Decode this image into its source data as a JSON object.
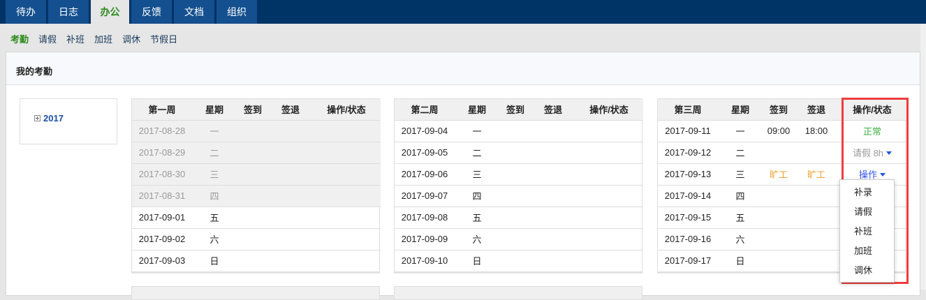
{
  "topnav": {
    "tabs": [
      "待办",
      "日志",
      "办公",
      "反馈",
      "文档",
      "组织"
    ],
    "active": 2
  },
  "subnav": {
    "items": [
      "考勤",
      "请假",
      "补班",
      "加班",
      "调休",
      "节假日"
    ],
    "active": 0
  },
  "panel": {
    "title": "我的考勤"
  },
  "tree": {
    "year": "2017"
  },
  "headers": [
    "星期",
    "签到",
    "签退",
    "操作/状态"
  ],
  "weeks": [
    {
      "title": "第一周",
      "rows": [
        {
          "date": "2017-08-28",
          "day": "一",
          "past": true
        },
        {
          "date": "2017-08-29",
          "day": "二",
          "past": true
        },
        {
          "date": "2017-08-30",
          "day": "三",
          "past": true
        },
        {
          "date": "2017-08-31",
          "day": "四",
          "past": true
        },
        {
          "date": "2017-09-01",
          "day": "五"
        },
        {
          "date": "2017-09-02",
          "day": "六"
        },
        {
          "date": "2017-09-03",
          "day": "日"
        }
      ]
    },
    {
      "title": "第二周",
      "rows": [
        {
          "date": "2017-09-04",
          "day": "一"
        },
        {
          "date": "2017-09-05",
          "day": "二"
        },
        {
          "date": "2017-09-06",
          "day": "三"
        },
        {
          "date": "2017-09-07",
          "day": "四"
        },
        {
          "date": "2017-09-08",
          "day": "五"
        },
        {
          "date": "2017-09-09",
          "day": "六"
        },
        {
          "date": "2017-09-10",
          "day": "日"
        }
      ]
    },
    {
      "title": "第三周",
      "rows": [
        {
          "date": "2017-09-11",
          "day": "一",
          "in": "09:00",
          "out": "18:00",
          "status": "正常",
          "statusType": "ok"
        },
        {
          "date": "2017-09-12",
          "day": "二",
          "status": "请假 8h",
          "statusType": "leave"
        },
        {
          "date": "2017-09-13",
          "day": "三",
          "in": "旷工",
          "out": "旷工",
          "inType": "abs",
          "status": "操作",
          "statusType": "op"
        },
        {
          "date": "2017-09-14",
          "day": "四"
        },
        {
          "date": "2017-09-15",
          "day": "五"
        },
        {
          "date": "2017-09-16",
          "day": "六"
        },
        {
          "date": "2017-09-17",
          "day": "日"
        }
      ]
    }
  ],
  "dropdown": [
    "补录",
    "请假",
    "补班",
    "加班",
    "调休"
  ],
  "colors": {
    "nav": "#003366",
    "tab": "#14508f",
    "active": "#2e8b1e",
    "highlight": "#f03c3c"
  }
}
